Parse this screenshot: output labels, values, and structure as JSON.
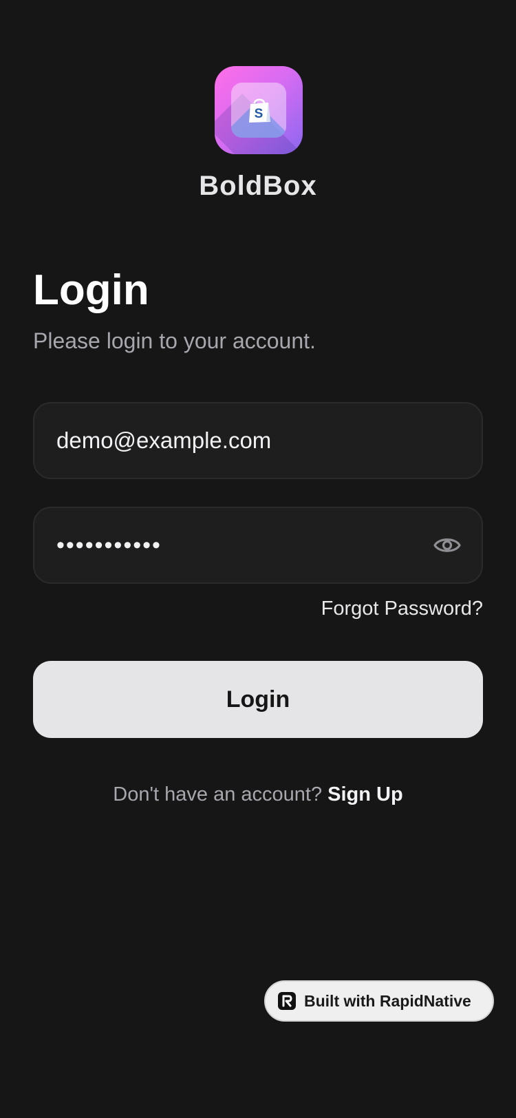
{
  "app": {
    "name": "BoldBox",
    "logo_icon": "shopping-bag-icon",
    "logo_gradient": [
      "#ff6ee8",
      "#8b67f0"
    ]
  },
  "login": {
    "title": "Login",
    "subtitle": "Please login to your account.",
    "email_value": "demo@example.com",
    "password_value": "•••••••••••",
    "password_toggle_icon": "eye-icon",
    "forgot_label": "Forgot Password?",
    "submit_label": "Login"
  },
  "signup": {
    "prompt": "Don't have an account?",
    "link_label": "Sign Up"
  },
  "badge": {
    "icon": "rapidnative-logo-icon",
    "label": "Built with RapidNative"
  },
  "colors": {
    "background": "#161616",
    "field_background": "#1e1e1f",
    "button_background": "#e5e5e8",
    "muted_text": "#a7a7ad"
  }
}
